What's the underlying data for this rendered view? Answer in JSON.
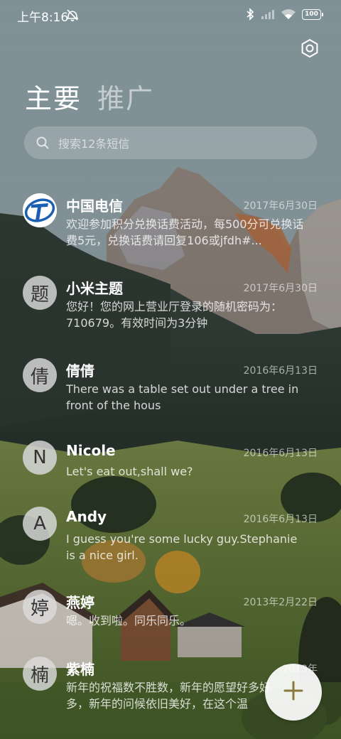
{
  "status_bar": {
    "time": "上午8:16",
    "battery": "100"
  },
  "tabs": [
    {
      "label": "主要"
    },
    {
      "label": "推广"
    }
  ],
  "search": {
    "placeholder": "搜索12条短信"
  },
  "messages": [
    {
      "name": "中国电信",
      "avatar": "",
      "date": "2017年6月30日",
      "preview": "欢迎参加积分兑换话费活动，每500分可兑换话费5元，兑换话费请回复106或jfdh#..."
    },
    {
      "name": "小米主题",
      "avatar": "题",
      "date": "2017年6月30日",
      "preview": "您好！您的网上营业厅登录的随机密码为：710679。有效时间为3分钟"
    },
    {
      "name": "倩倩",
      "avatar": "倩",
      "date": "2016年6月13日",
      "preview": "There was a table set out under a tree in front of the hous"
    },
    {
      "name": "Nicole",
      "avatar": "N",
      "date": "2016年6月13日",
      "preview": "Let's eat out,shall we?"
    },
    {
      "name": "Andy",
      "avatar": "A",
      "date": "2016年6月13日",
      "preview": "I guess you're some lucky guy.Stephanie is a nice girl."
    },
    {
      "name": "燕婷",
      "avatar": "婷",
      "date": "2013年2月22日",
      "preview": "嗯。收到啦。同乐同乐。"
    },
    {
      "name": "紫楠",
      "avatar": "楠",
      "date": "2013年",
      "preview": "新年的祝福数不胜数，新年的愿望好多好多，新年的问候依旧美好，在这个温"
    }
  ],
  "icons": {
    "settings": "settings-icon",
    "search": "search-icon",
    "compose": "plus-icon"
  },
  "colors": {
    "accent": "#8a7a3a"
  }
}
